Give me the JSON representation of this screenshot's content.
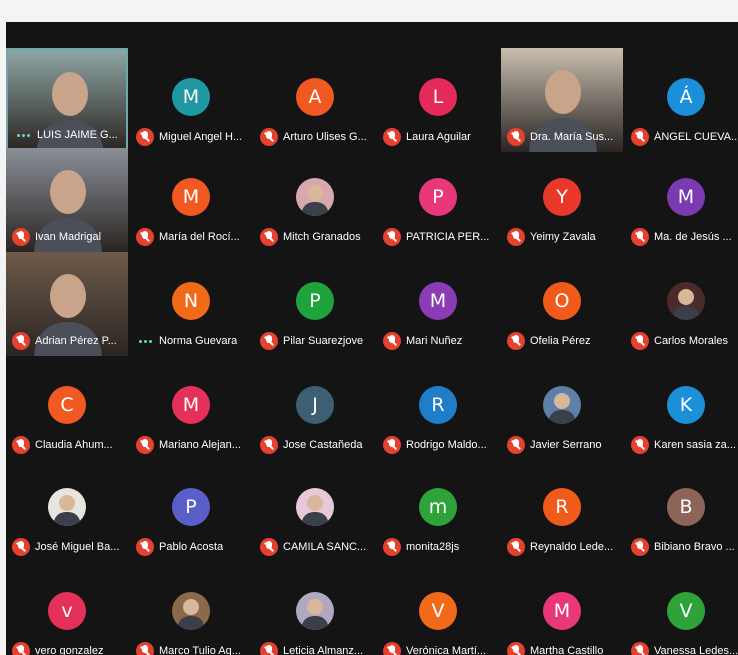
{
  "participants": [
    {
      "name": "LUIS JAIME G...",
      "type": "video",
      "mic": "active",
      "highlight": true,
      "bg": "#8fa6a4"
    },
    {
      "name": "Miguel Angel H...",
      "initial": "M",
      "color": "#1f98a3",
      "mic": "muted"
    },
    {
      "name": "Arturo Ulises G...",
      "initial": "A",
      "color": "#f05a22",
      "mic": "muted"
    },
    {
      "name": "Laura Aguilar",
      "initial": "L",
      "color": "#e32a58",
      "mic": "muted"
    },
    {
      "name": "Dra. María Sus...",
      "type": "video",
      "mic": "muted",
      "bg": "#c9bfb0"
    },
    {
      "name": "ÁNGEL CUEVA...",
      "initial": "Á",
      "color": "#1b8fd8",
      "mic": "muted"
    },
    {
      "name": "Ivan Madrigal",
      "type": "video",
      "mic": "muted",
      "bg": "#8a8f97"
    },
    {
      "name": "María del Rocí...",
      "initial": "M",
      "color": "#f05a22",
      "mic": "muted"
    },
    {
      "name": "Mitch Granados",
      "type": "photo",
      "color": "#d8a8b0",
      "mic": "muted"
    },
    {
      "name": "PATRICIA PER...",
      "initial": "P",
      "color": "#e8387a",
      "mic": "muted"
    },
    {
      "name": "Yeimy Zavala",
      "initial": "Y",
      "color": "#e8382a",
      "mic": "muted"
    },
    {
      "name": "Ma. de Jesús ...",
      "initial": "M",
      "color": "#7a3bb0",
      "mic": "muted"
    },
    {
      "name": "Adrian Pérez P...",
      "type": "video",
      "mic": "muted",
      "bg": "#6e5a4a"
    },
    {
      "name": "Norma Guevara",
      "initial": "N",
      "color": "#f06a1a",
      "mic": "active"
    },
    {
      "name": "Pilar Suarezjove",
      "initial": "P",
      "color": "#1fa33c",
      "mic": "muted"
    },
    {
      "name": "Mari Nuñez",
      "initial": "M",
      "color": "#8a3cb5",
      "mic": "muted"
    },
    {
      "name": "Ofelia Pérez",
      "initial": "O",
      "color": "#f05a1a",
      "mic": "muted"
    },
    {
      "name": "Carlos Morales",
      "type": "photo",
      "color": "#4a2a2a",
      "mic": "muted"
    },
    {
      "name": "Claudia Ahum...",
      "initial": "C",
      "color": "#f05a22",
      "mic": "muted"
    },
    {
      "name": "Mariano Alejan...",
      "initial": "M",
      "color": "#e5305a",
      "mic": "muted"
    },
    {
      "name": "Jose Castañeda",
      "initial": "J",
      "color": "#3d5f73",
      "mic": "muted"
    },
    {
      "name": "Rodrigo Maldo...",
      "initial": "R",
      "color": "#1f7ec8",
      "mic": "muted"
    },
    {
      "name": "Javier Serrano",
      "type": "photo",
      "color": "#5d7fa8",
      "mic": "muted"
    },
    {
      "name": "Karen sasia za...",
      "initial": "K",
      "color": "#1b8fd8",
      "mic": "muted"
    },
    {
      "name": "José Miguel Ba...",
      "type": "photo",
      "color": "#e8e4de",
      "mic": "muted"
    },
    {
      "name": "Pablo Acosta",
      "initial": "P",
      "color": "#5a5fc8",
      "mic": "muted"
    },
    {
      "name": "CAMILA SANC...",
      "type": "photo",
      "color": "#e7c8d8",
      "mic": "muted"
    },
    {
      "name": "monita28js",
      "initial": "m",
      "color": "#2ea33a",
      "mic": "muted"
    },
    {
      "name": "Reynaldo Lede...",
      "initial": "R",
      "color": "#f05a1a",
      "mic": "muted"
    },
    {
      "name": "Bibiano Bravo ...",
      "initial": "B",
      "color": "#8d6458",
      "mic": "muted"
    },
    {
      "name": "vero gonzalez",
      "initial": "v",
      "color": "#e5305a",
      "mic": "muted"
    },
    {
      "name": "Marco Tulio Ag...",
      "type": "photo",
      "color": "#8a6a4a",
      "mic": "muted"
    },
    {
      "name": "Leticia Almanz...",
      "type": "photo",
      "color": "#b0a8c0",
      "mic": "muted"
    },
    {
      "name": "Verónica Martí...",
      "initial": "V",
      "color": "#f06a1a",
      "mic": "muted"
    },
    {
      "name": "Martha Castillo",
      "initial": "M",
      "color": "#e8387a",
      "mic": "muted"
    },
    {
      "name": "Vanessa Ledes...",
      "initial": "V",
      "color": "#2ea33a",
      "mic": "muted"
    }
  ]
}
